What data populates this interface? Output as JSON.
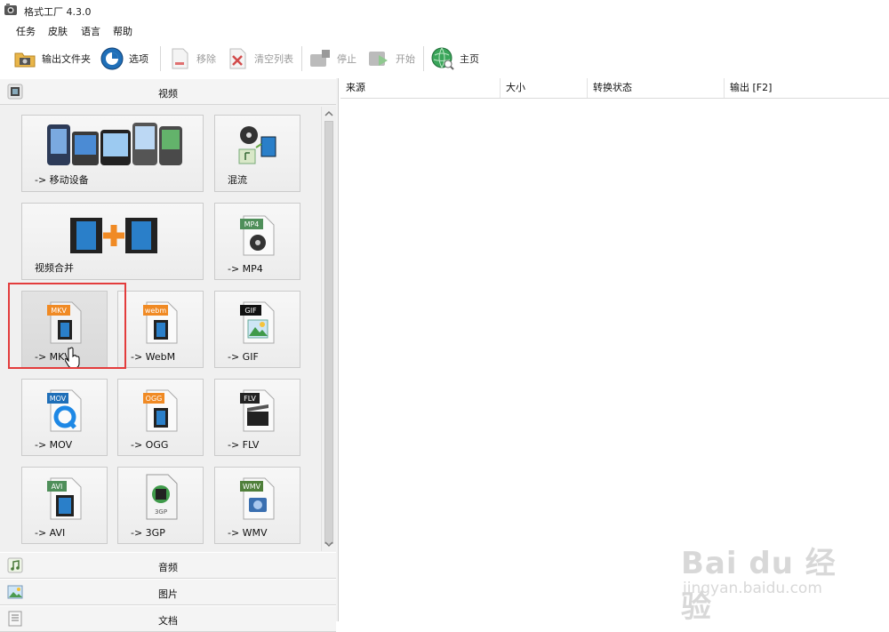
{
  "window": {
    "title": "格式工厂 4.3.0"
  },
  "menu": [
    "任务",
    "皮肤",
    "语言",
    "帮助"
  ],
  "toolbar": {
    "output_folder": "输出文件夹",
    "options": "选项",
    "remove": "移除",
    "clear_list": "清空列表",
    "stop": "停止",
    "start": "开始",
    "home": "主页"
  },
  "categories": {
    "video": "视频",
    "audio": "音频",
    "picture": "图片",
    "document": "文档"
  },
  "tiles": {
    "mobile": "-> 移动设备",
    "mux": "混流",
    "join": "视频合并",
    "mp4": "-> MP4",
    "mkv": "-> MKV",
    "webm": "-> WebM",
    "gif": "-> GIF",
    "mov": "-> MOV",
    "ogg": "-> OGG",
    "flv": "-> FLV",
    "avi": "-> AVI",
    "3gp": "-> 3GP",
    "wmv": "-> WMV"
  },
  "badges": {
    "mp4": "MP4",
    "mkv": "MKV",
    "webm": "webm",
    "gif": "GIF",
    "mov": "MOV",
    "ogg": "OGG",
    "flv": "FLV",
    "avi": "AVI",
    "3gp": "3GP",
    "wmv": "WMV"
  },
  "file_list": {
    "columns": [
      "来源",
      "大小",
      "转换状态",
      "输出 [F2]"
    ]
  },
  "watermark": {
    "brand": "Bai du 经验",
    "url": "jingyan.baidu.com"
  },
  "colors": {
    "highlight": "#e33c3c",
    "accent_orange": "#f08a24",
    "film_blue": "#2a7fc9"
  }
}
